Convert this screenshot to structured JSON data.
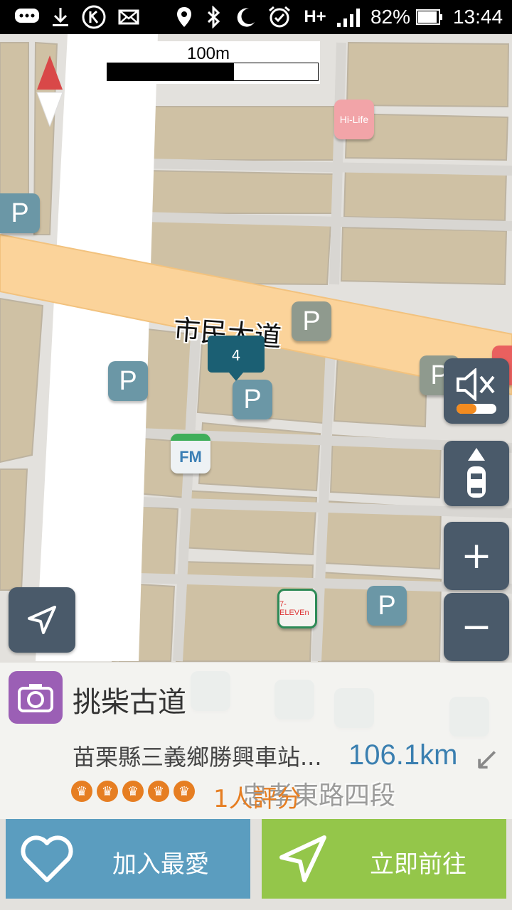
{
  "status_bar": {
    "battery": "82%",
    "time": "13:44",
    "network": "H+"
  },
  "map": {
    "scale_label": "100m",
    "road_label": "市民大道",
    "faded_road_label": "忠孝東路四段",
    "pin_count": "4",
    "poi_labels": {
      "hilife": "Hi-Life",
      "familymart": "FM",
      "seven_eleven": "7-ELEVEn",
      "parking": "P"
    }
  },
  "controls": {
    "zoom_in": "+",
    "zoom_out": "−"
  },
  "place": {
    "name": "挑柴古道",
    "address": "苗栗縣三義鄉勝興車站...",
    "distance": "106.1km",
    "rating_count": "1人評分",
    "stars": 5
  },
  "actions": {
    "favorite_label": "加入最愛",
    "navigate_label": "立即前往"
  },
  "colors": {
    "favorite_button": "#5b9dbf",
    "navigate_button": "#94c64a",
    "rating_orange": "#e67e22",
    "distance_blue": "#3a7fb0",
    "main_road": "#fbd39a",
    "blocks": "#cfc1a4"
  }
}
